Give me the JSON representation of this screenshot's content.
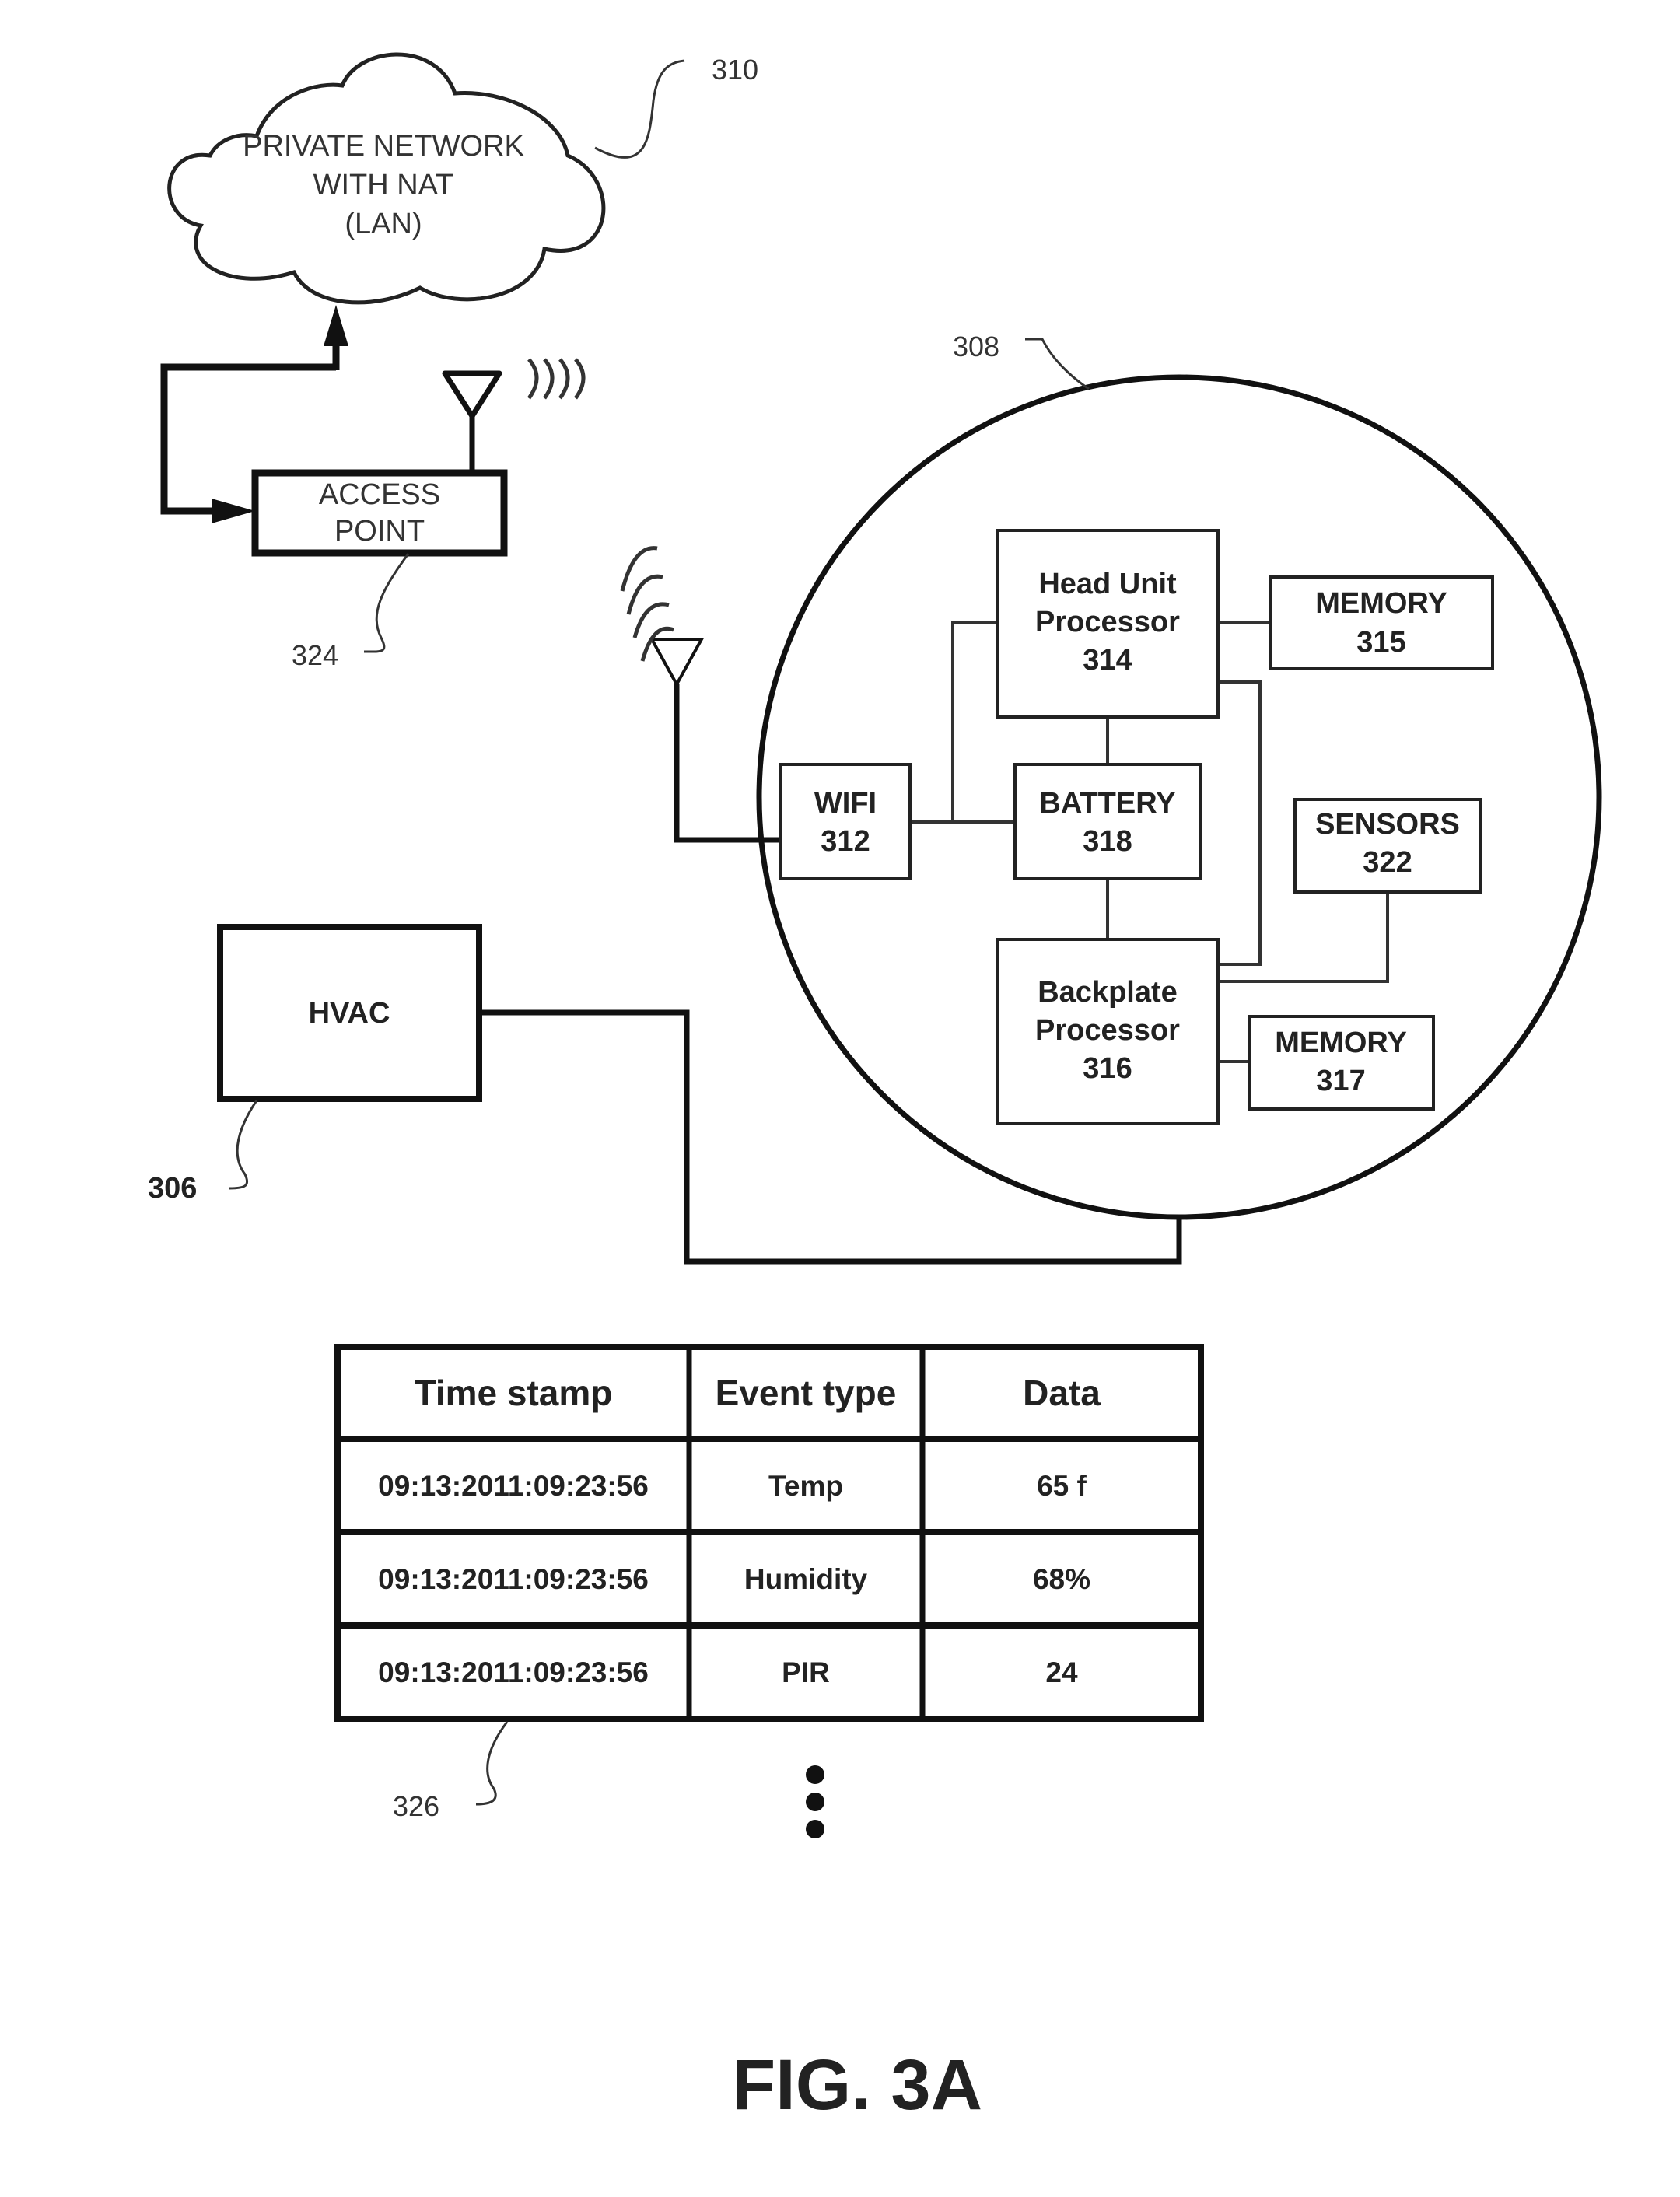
{
  "figure": {
    "title": "FIG. 3A"
  },
  "network": {
    "cloud_lines": [
      "PRIVATE NETWORK",
      "WITH NAT",
      "(LAN)"
    ],
    "cloud_ref": "310",
    "access_point_lines": [
      "ACCESS",
      "POINT"
    ],
    "access_point_ref": "324"
  },
  "thermostat": {
    "ref": "308",
    "blocks": {
      "head_unit": [
        "Head Unit",
        "Processor",
        "314"
      ],
      "memory_315": [
        "MEMORY",
        "315"
      ],
      "wifi": [
        "WIFI",
        "312"
      ],
      "battery": [
        "BATTERY",
        "318"
      ],
      "sensors": [
        "SENSORS",
        "322"
      ],
      "backplate": [
        "Backplate",
        "Processor",
        "316"
      ],
      "memory_317": [
        "MEMORY",
        "317"
      ]
    }
  },
  "hvac": {
    "label": "HVAC",
    "ref": "306"
  },
  "event_table": {
    "ref": "326",
    "headers": [
      "Time stamp",
      "Event type",
      "Data"
    ],
    "rows": [
      [
        "09:13:2011:09:23:56",
        "Temp",
        "65 f"
      ],
      [
        "09:13:2011:09:23:56",
        "Humidity",
        "68%"
      ],
      [
        "09:13:2011:09:23:56",
        "PIR",
        "24"
      ]
    ],
    "continuation": "more-rows-ellipsis"
  }
}
